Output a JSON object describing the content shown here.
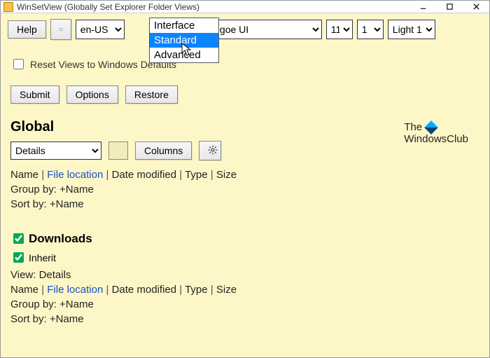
{
  "window": {
    "title": "WinSetView (Globally Set Explorer Folder Views)"
  },
  "toolbar": {
    "help": "Help",
    "lang": "en-US",
    "font": "Segoe UI",
    "size1": "11",
    "size2": "1",
    "theme": "Light 1"
  },
  "dropdown": {
    "opt0": "Interface",
    "opt1": "Standard",
    "opt2": "Advanced"
  },
  "reset": {
    "label": "Reset Views to Windows Defaults"
  },
  "actions": {
    "submit": "Submit",
    "options": "Options",
    "restore": "Restore"
  },
  "global": {
    "heading": "Global",
    "view": "Details",
    "columns_btn": "Columns",
    "cols_name": "Name",
    "cols_fileloc": "File location",
    "cols_datemod": "Date modified",
    "cols_type": "Type",
    "cols_size": "Size",
    "groupby": "Group by: +Name",
    "sortby": "Sort by: +Name"
  },
  "logo": {
    "line1": "The",
    "line2": "WindowsClub"
  },
  "downloads": {
    "heading": "Downloads",
    "inherit": "Inherit",
    "view_label": "View: Details",
    "cols_name": "Name",
    "cols_fileloc": "File location",
    "cols_datemod": "Date modified",
    "cols_type": "Type",
    "cols_size": "Size",
    "groupby": "Group by: +Name",
    "sortby": "Sort by: +Name"
  }
}
